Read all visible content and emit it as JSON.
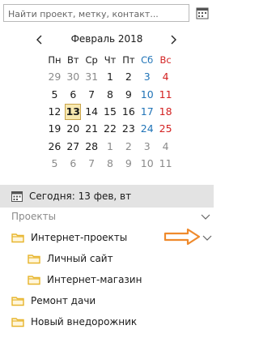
{
  "search": {
    "placeholder": "Найти проект, метку, контакт..."
  },
  "calendar": {
    "month_title": "Февраль 2018",
    "weekdays": [
      "Пн",
      "Вт",
      "Ср",
      "Чт",
      "Пт",
      "Сб",
      "Вс"
    ],
    "weeks": [
      [
        "29",
        "30",
        "31",
        "1",
        "2",
        "3",
        "4"
      ],
      [
        "5",
        "6",
        "7",
        "8",
        "9",
        "10",
        "11"
      ],
      [
        "12",
        "13",
        "14",
        "15",
        "16",
        "17",
        "18"
      ],
      [
        "19",
        "20",
        "21",
        "22",
        "23",
        "24",
        "25"
      ],
      [
        "26",
        "27",
        "28",
        "1",
        "2",
        "3",
        "4"
      ],
      [
        "5",
        "6",
        "7",
        "8",
        "9",
        "10",
        "11"
      ]
    ],
    "today_label": "Сегодня: 13 фев, вт"
  },
  "projects": {
    "section_label": "Проекты",
    "items": [
      {
        "label": "Интернет-проекты",
        "level": 0
      },
      {
        "label": "Личный сайт",
        "level": 1
      },
      {
        "label": "Интернет-магазин",
        "level": 1
      },
      {
        "label": "Ремонт дачи",
        "level": 0
      },
      {
        "label": "Новый внедорожник",
        "level": 0
      }
    ]
  },
  "colors": {
    "folder": "#e7b52d",
    "arrow": "#ef8a2c",
    "saturday": "#1f73b7",
    "sunday": "#d32222",
    "muted": "#8a8a8a"
  }
}
